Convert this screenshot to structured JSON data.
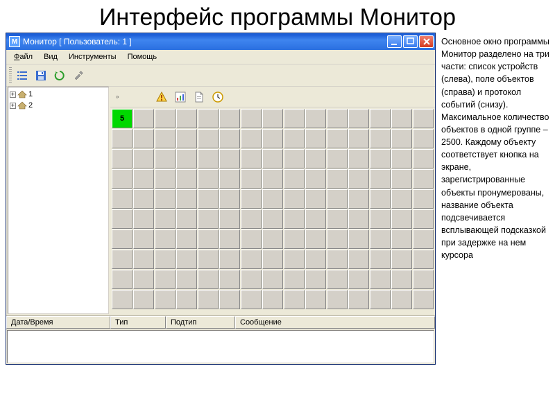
{
  "slide": {
    "title": "Интерфейс программы Монитор",
    "description": "Основное окно программы Монитор разделено на три части: список устройств (слева), поле объектов (справа) и протокол событий (снизу). Максимальное количество объектов в одной группе – 2500. Каждому объекту соответствует кнопка на экране, зарегистрированные объекты пронумерованы, название объекта подсвечивается всплывающей подсказкой при задержке на нем курсора"
  },
  "window": {
    "app_icon_letter": "M",
    "title": "Монитор  [ Пользователь: 1 ]"
  },
  "menubar": {
    "file": "Файл",
    "view": "Вид",
    "tools": "Инструменты",
    "help": "Помощь"
  },
  "toolbar_left": {
    "list": "list-icon",
    "save": "save-icon",
    "refresh": "refresh-icon",
    "wrench": "wrench-icon"
  },
  "main_toolbar": {
    "warn": "warning-icon",
    "chart": "chart-icon",
    "doc": "document-icon",
    "clock": "clock-icon"
  },
  "grid": {
    "cols": 15,
    "rows": 10,
    "active_cell_index": 0,
    "active_cell_label": "5"
  },
  "log": {
    "col_datetime": "Дата/Время",
    "col_type": "Тип",
    "col_subtype": "Подтип",
    "col_message": "Сообщение"
  }
}
